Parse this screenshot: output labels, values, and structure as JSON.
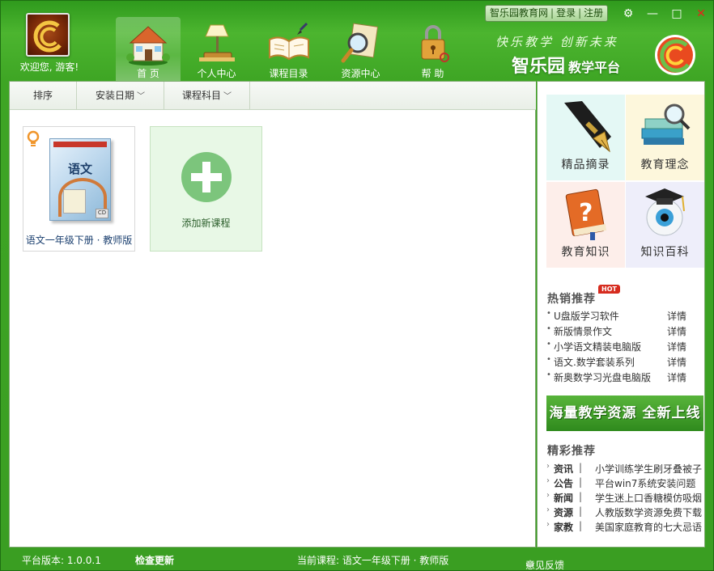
{
  "user": {
    "welcome": "欢迎您, 游客!"
  },
  "nav": {
    "items": [
      {
        "label": "首 页",
        "icon": "house-icon",
        "active": true
      },
      {
        "label": "个人中心",
        "icon": "lamp-icon"
      },
      {
        "label": "课程目录",
        "icon": "open-book-icon"
      },
      {
        "label": "资源中心",
        "icon": "magnifier-icon"
      },
      {
        "label": "帮 助",
        "icon": "lock-icon"
      }
    ]
  },
  "header": {
    "slogan": "快乐教学 创新未来",
    "brand": "智乐园",
    "brand_sub": "教学平台",
    "links": {
      "site": "智乐园教育网",
      "login": "登录",
      "register": "注册"
    }
  },
  "toolbar": {
    "sort": "排序",
    "install_date": "安装日期",
    "subject": "课程科目"
  },
  "courses": [
    {
      "name": "语文一年级下册 · 教师版",
      "cover_title": "语文"
    }
  ],
  "add_course": {
    "label": "添加新课程"
  },
  "tiles": [
    {
      "label": "精品摘录",
      "icon": "fountain-pen-icon",
      "bg": "#e4f8f5"
    },
    {
      "label": "教育理念",
      "icon": "books-magnifier-icon",
      "bg": "#fdf7dc"
    },
    {
      "label": "教育知识",
      "icon": "question-book-icon",
      "bg": "#fdeeea"
    },
    {
      "label": "知识百科",
      "icon": "eye-graduation-icon",
      "bg": "#eeeefa"
    }
  ],
  "hot": {
    "title": "热销推荐",
    "badge": "HOT",
    "more_label": "详情",
    "items": [
      "U盘版学习软件",
      "新版情景作文",
      "小学语文精装电脑版",
      "语文.数学套装系列",
      "新奥数学习光盘电脑版"
    ]
  },
  "banner": {
    "text": "海量教学资源 全新上线"
  },
  "featured": {
    "title": "精彩推荐",
    "items": [
      {
        "category": "资讯",
        "text": "小学训练学生刷牙叠被子"
      },
      {
        "category": "公告",
        "text": "平台win7系统安装问题"
      },
      {
        "category": "新闻",
        "text": "学生迷上口香糖模仿吸烟"
      },
      {
        "category": "资源",
        "text": "人教版数学资源免费下载"
      },
      {
        "category": "家教",
        "text": "美国家庭教育的七大忌语"
      }
    ]
  },
  "status": {
    "version": "平台版本: 1.0.0.1",
    "check_update": "检查更新",
    "current_course": "当前课程: 语文一年级下册 · 教师版",
    "feedback": "意见反馈"
  },
  "colors": {
    "theme_green": "#3fa42b",
    "accent_red": "#d62b1e"
  }
}
